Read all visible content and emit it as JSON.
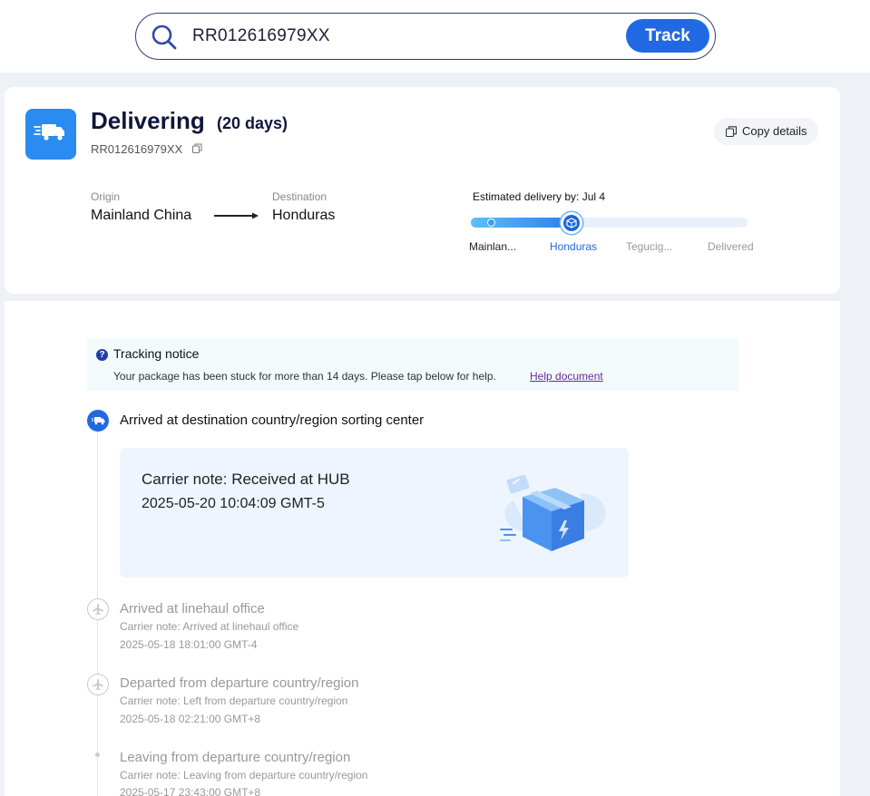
{
  "search": {
    "value": "RR012616979XX",
    "button_label": "Track"
  },
  "summary": {
    "status": "Delivering",
    "days": "(20 days)",
    "tracking_number": "RR012616979XX",
    "copy_label": "Copy details",
    "origin_label": "Origin",
    "origin": "Mainland China",
    "destination_label": "Destination",
    "destination": "Honduras",
    "eta_label": "Estimated delivery by:  Jul 4",
    "progress_fraction": 0.37,
    "steps": [
      {
        "label": "Mainlan...",
        "state": "done"
      },
      {
        "label": "Honduras",
        "state": "current"
      },
      {
        "label": "Tegucig...",
        "state": "pending"
      },
      {
        "label": "Delivered",
        "state": "pending"
      }
    ]
  },
  "notice": {
    "title": "Tracking notice",
    "message": "Your package has been stuck for more than 14 days. Please tap below for help.",
    "link": "Help document"
  },
  "events": [
    {
      "title": "Arrived at destination country/region sorting center",
      "note": "Carrier note: Received at HUB",
      "time": "2025-05-20 10:04:09 GMT-5",
      "icon": "truck-icon"
    },
    {
      "title": "Arrived at linehaul office",
      "note": "Carrier note: Arrived at linehaul office",
      "time": "2025-05-18 18:01:00 GMT-4",
      "icon": "plane-icon"
    },
    {
      "title": "Departed from departure country/region",
      "note": "Carrier note: Left from departure country/region",
      "time": "2025-05-18 02:21:00 GMT+8",
      "icon": "plane-icon"
    },
    {
      "title": "Leaving from departure country/region",
      "note": "Carrier note: Leaving from departure country/region",
      "time": "2025-05-17 23:43:00 GMT+8",
      "icon": "dot-icon"
    }
  ],
  "colors": {
    "accent": "#2169e3",
    "badge": "#2a8cf0",
    "link": "#6a2a9a"
  }
}
